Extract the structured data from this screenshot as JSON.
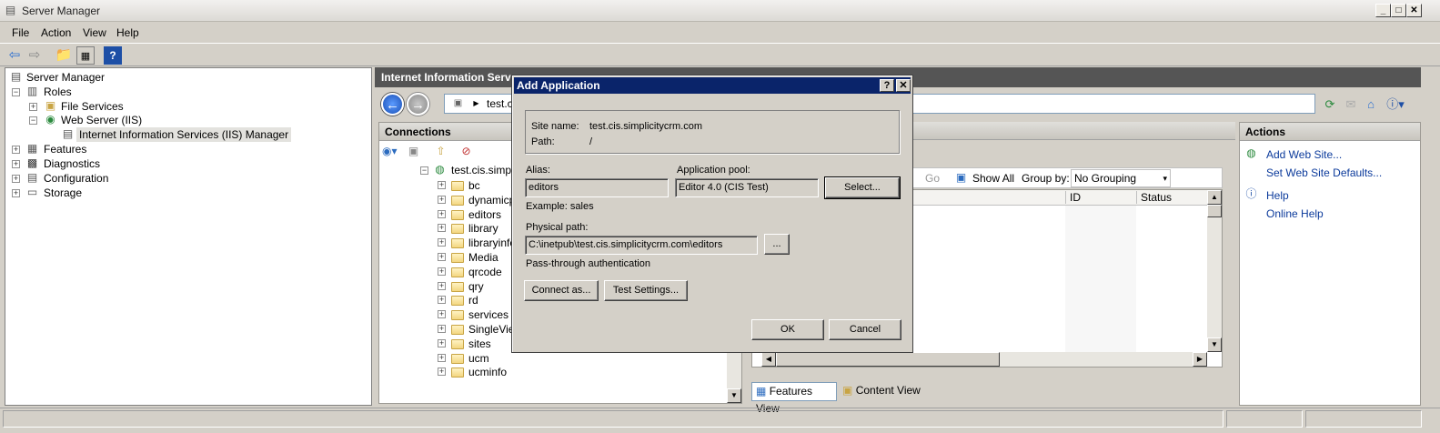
{
  "window": {
    "title": "Server Manager"
  },
  "menu": [
    "File",
    "Action",
    "View",
    "Help"
  ],
  "tree": {
    "root": "Server Manager",
    "roles": "Roles",
    "file_services": "File Services",
    "web_server": "Web Server (IIS)",
    "iis_manager": "Internet Information Services (IIS) Manager",
    "features": "Features",
    "diagnostics": "Diagnostics",
    "configuration": "Configuration",
    "storage": "Storage"
  },
  "iis": {
    "header": "Internet Information Serv",
    "address": "test.c",
    "connections_title": "Connections",
    "site": "test.cis.simplic",
    "folders": [
      "bc",
      "dynamicp",
      "editors",
      "library",
      "libraryinfc",
      "Media",
      "qrcode",
      "qry",
      "rd",
      "services",
      "SingleView",
      "sites",
      "ucm",
      "ucminfo"
    ],
    "filter": {
      "go": "Go",
      "show_all": "Show All",
      "group_by": "Group by:",
      "group_value": "No Grouping"
    },
    "columns": [
      "ID",
      "Status"
    ],
    "views": {
      "features": "Features View",
      "content": "Content View"
    }
  },
  "actions": {
    "title": "Actions",
    "add_site": "Add Web Site...",
    "set_defaults": "Set Web Site Defaults...",
    "help": "Help",
    "online_help": "Online Help"
  },
  "dialog": {
    "title": "Add Application",
    "site_name_label": "Site name:",
    "site_name": "test.cis.simplicitycrm.com",
    "path_label": "Path:",
    "path": "/",
    "alias_label": "Alias:",
    "alias": "editors",
    "pool_label": "Application pool:",
    "pool": "Editor 4.0 (CIS Test)",
    "select_btn": "Select...",
    "example": "Example: sales",
    "physical_label": "Physical path:",
    "physical_path": "C:\\inetpub\\test.cis.simplicitycrm.com\\editors",
    "browse_btn": "...",
    "passthrough": "Pass-through authentication",
    "connect_btn": "Connect as...",
    "test_btn": "Test Settings...",
    "ok_btn": "OK",
    "cancel_btn": "Cancel",
    "help_glyph": "?",
    "close_glyph": "✕"
  }
}
